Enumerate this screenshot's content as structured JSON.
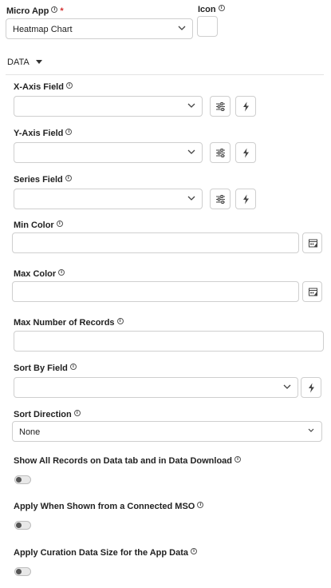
{
  "micro_app": {
    "label": "Micro App",
    "required_mark": "*",
    "value": "Heatmap Chart"
  },
  "icon_field": {
    "label": "Icon"
  },
  "section": {
    "title": "DATA"
  },
  "fields": {
    "x_axis": {
      "label": "X-Axis Field",
      "value": ""
    },
    "y_axis": {
      "label": "Y-Axis Field",
      "value": ""
    },
    "series": {
      "label": "Series Field",
      "value": ""
    },
    "min_color": {
      "label": "Min Color",
      "value": ""
    },
    "max_color": {
      "label": "Max Color",
      "value": ""
    },
    "max_records": {
      "label": "Max Number of Records",
      "value": ""
    },
    "sort_by": {
      "label": "Sort By Field",
      "value": ""
    },
    "sort_direction": {
      "label": "Sort Direction",
      "value": "None"
    }
  },
  "toggles": {
    "show_all_records": {
      "label": "Show All Records on Data tab and in Data Download",
      "on": false
    },
    "apply_connected_mso": {
      "label": "Apply When Shown from a Connected MSO",
      "on": false
    },
    "apply_curation": {
      "label": "Apply Curation Data Size for the App Data",
      "on": false
    }
  },
  "icons": {
    "info": "info-icon",
    "chevron": "chevron-down-icon",
    "settings": "sliders-icon",
    "dynamic": "lightning-bolt-icon",
    "color_picker": "color-palette-icon"
  }
}
